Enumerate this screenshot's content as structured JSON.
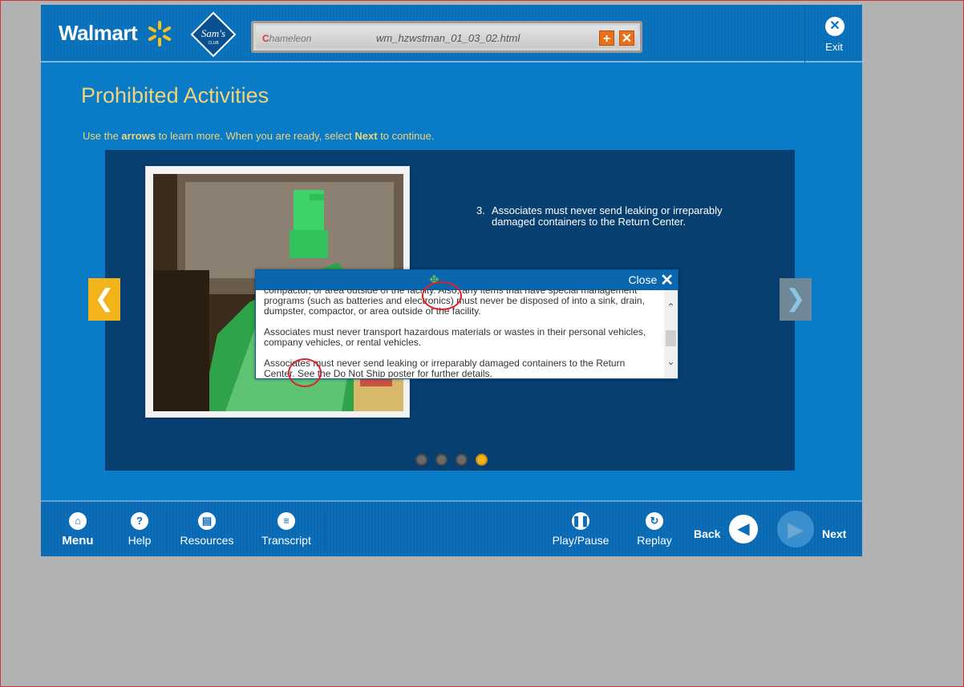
{
  "header": {
    "brand": "Walmart",
    "sams_logo": "Sam's CLUB",
    "player": {
      "logo_text": "hameleon",
      "logo_initial": "C",
      "filename": "wm_hzwstman_01_03_02.html",
      "plus_icon": "plus-icon",
      "close_icon": "close-icon"
    },
    "exit_label": "Exit"
  },
  "page": {
    "title": "Prohibited Activities",
    "instructions": {
      "part1": "Use the ",
      "arrows": "arrows",
      "part2": " to learn more.  When you are ready, select ",
      "next": "Next",
      "part3": " to continue."
    }
  },
  "slide": {
    "point_number": "3.",
    "point_text": "Associates must never send leaking or irreparably damaged containers to the Return Center.",
    "dots": {
      "total": 4,
      "active": 4
    }
  },
  "popup": {
    "close_label": "Close",
    "paragraphs": [
      "compactor, or area outside of the facility. Also, any items that have special management programs (such as batteries and electronics) must never be disposed of into a sink, drain, dumpster, compactor, or area outside of the facility.",
      "Associates must never transport hazardous materials or wastes in their personal vehicles, company vehicles, or rental vehicles.",
      "Associates must never send leaking or irreparably damaged containers to the Return Center. See the Do Not Ship poster for further details."
    ]
  },
  "footer": {
    "menu": "Menu",
    "help": "Help",
    "resources": "Resources",
    "transcript": "Transcript",
    "play_pause": "Play/Pause",
    "replay": "Replay",
    "back": "Back",
    "next": "Next"
  },
  "colors": {
    "app_blue": "#0a7bc7",
    "panel_blue": "#063f70",
    "title_gold": "#f1d37a",
    "arrow_yellow": "#f2b41a",
    "annotation_red": "#e0202a"
  }
}
